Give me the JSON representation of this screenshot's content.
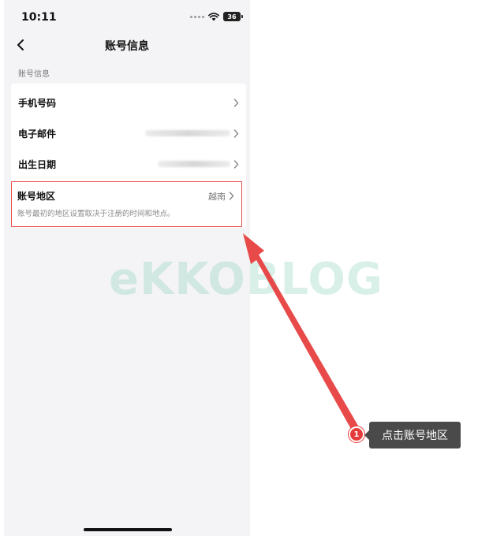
{
  "status_bar": {
    "time": "10:11",
    "battery": "36"
  },
  "nav": {
    "title": "账号信息",
    "back_icon": "chevron-left-icon"
  },
  "section": {
    "header": "账号信息"
  },
  "rows": [
    {
      "label": "手机号码",
      "value": ""
    },
    {
      "label": "电子邮件",
      "value": ""
    },
    {
      "label": "出生日期",
      "value": ""
    }
  ],
  "region": {
    "label": "账号地区",
    "value": "越南",
    "description": "账号最初的地区设置取决于注册的时间和地点。"
  },
  "watermark": {
    "text": "eKKOBLOG"
  },
  "annotation": {
    "step": "1",
    "text": "点击账号地区",
    "arrow_color": "#e63b3b",
    "highlight_color": "#e94b4b"
  }
}
